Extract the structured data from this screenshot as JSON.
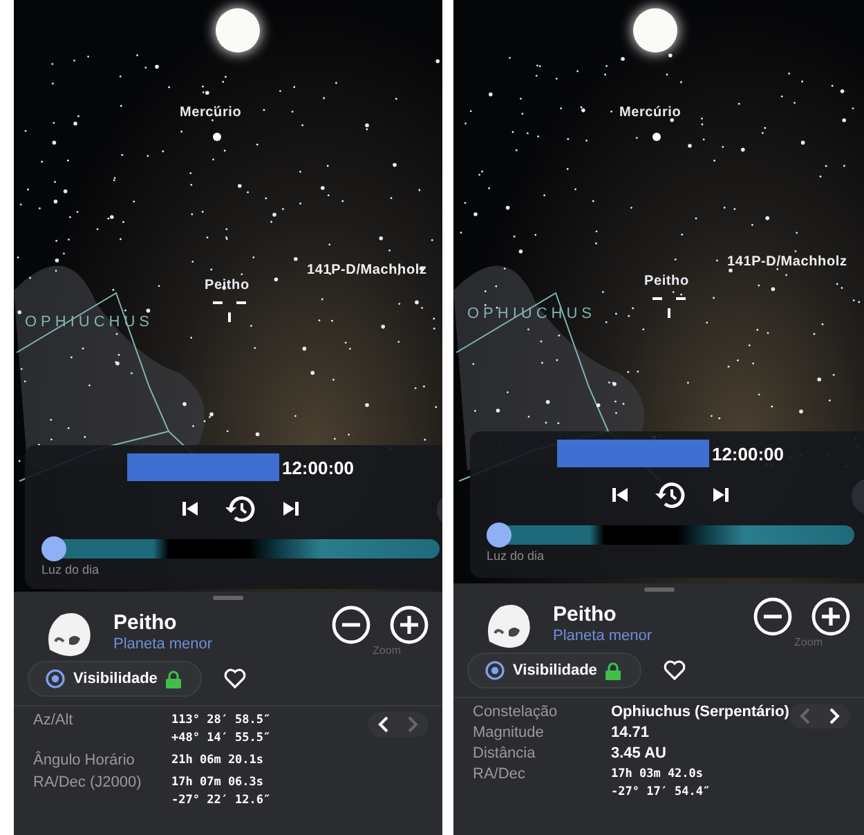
{
  "screens": [
    {
      "sky": {
        "labels": [
          {
            "text": "Mercúrio",
            "kind": "planet"
          },
          {
            "text": "Peitho",
            "kind": "target"
          },
          {
            "text": "141P-D/Machholz",
            "kind": "comet"
          },
          {
            "text": "OPHIUCHUS",
            "kind": "constellation"
          }
        ]
      },
      "time_panel": {
        "time": "12:00:00",
        "timeline": {
          "level": 0.0,
          "label": "Luz do dia"
        }
      },
      "object": {
        "name": "Peitho",
        "type": "Planeta menor",
        "zoom_label": "Zoom"
      },
      "visibility": {
        "label": "Visibilidade",
        "locked": true
      },
      "favorite": false,
      "pager": {
        "prev_enabled": true,
        "next_enabled": false
      },
      "rows": [
        {
          "label": "Az/Alt",
          "kind": "coord",
          "values": [
            "113° 28′ 58.5″",
            "+48° 14′ 55.5″"
          ]
        },
        {
          "label": "Ângulo Horário",
          "kind": "coord",
          "values": [
            "21h 06m 20.1s"
          ]
        },
        {
          "label": "RA/Dec (J2000)",
          "kind": "coord",
          "values": [
            "17h 07m 06.3s",
            "-27° 22′ 12.6″"
          ]
        }
      ]
    },
    {
      "sky": {
        "labels": [
          {
            "text": "Mercúrio",
            "kind": "planet"
          },
          {
            "text": "Peitho",
            "kind": "target"
          },
          {
            "text": "141P-D/Machholz",
            "kind": "comet"
          },
          {
            "text": "OPHIUCHUS",
            "kind": "constellation"
          }
        ]
      },
      "time_panel": {
        "time": "12:00:00",
        "timeline": {
          "level": 0.0,
          "label": "Luz do dia"
        }
      },
      "object": {
        "name": "Peitho",
        "type": "Planeta menor",
        "zoom_label": "Zoom"
      },
      "visibility": {
        "label": "Visibilidade",
        "locked": true
      },
      "favorite": false,
      "pager": {
        "prev_enabled": false,
        "next_enabled": true
      },
      "rows": [
        {
          "label": "Constelação",
          "kind": "text",
          "values": [
            "Ophiuchus (Serpentário)"
          ]
        },
        {
          "label": "Magnitude",
          "kind": "text",
          "values": [
            "14.71"
          ]
        },
        {
          "label": "Distância",
          "kind": "text",
          "values": [
            "**3.45** AU"
          ]
        },
        {
          "label": "RA/Dec",
          "kind": "coord",
          "values": [
            "17h 03m 42.0s",
            "-27° 17′ 54.4″"
          ]
        }
      ]
    }
  ]
}
